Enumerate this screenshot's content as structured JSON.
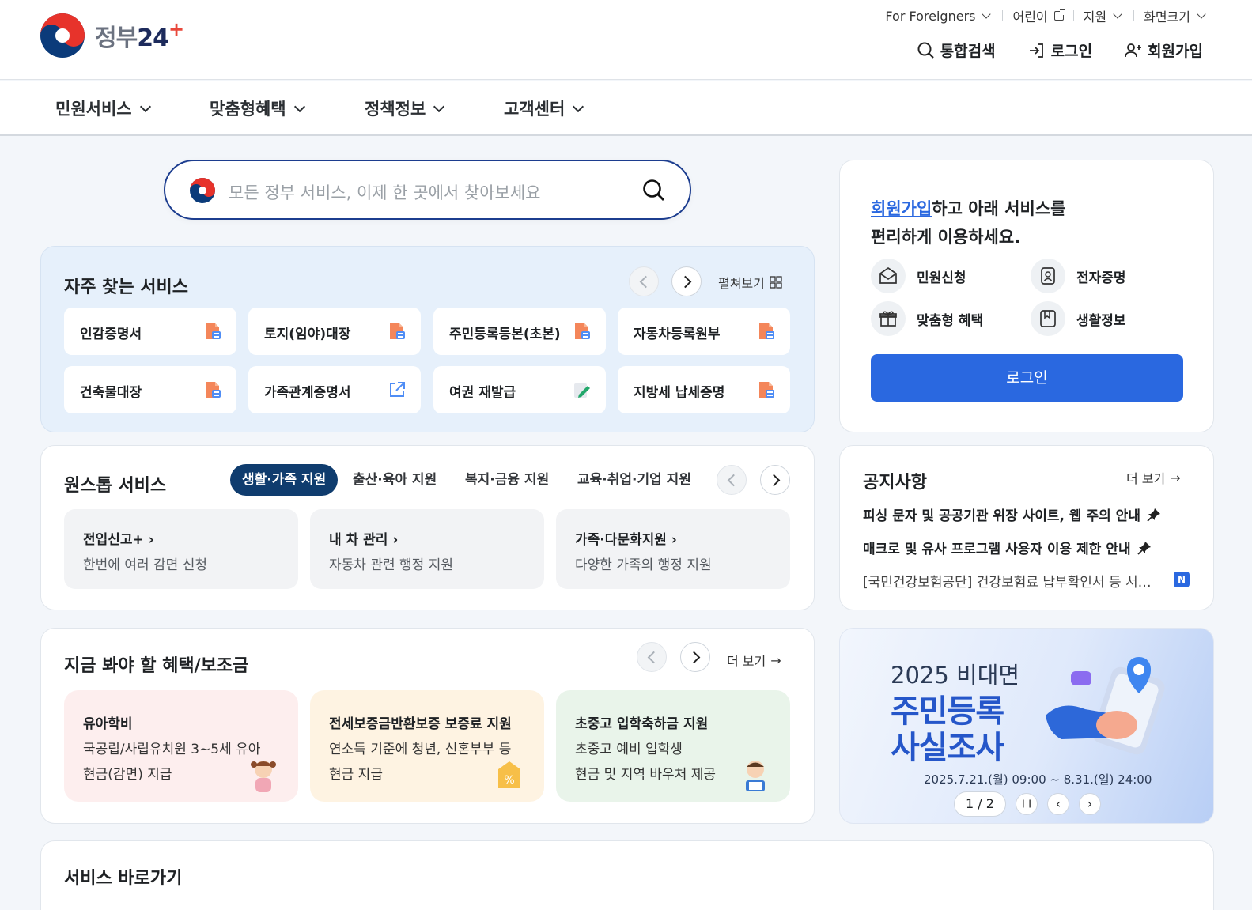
{
  "header": {
    "logo_text": "정부",
    "logo_num": "24",
    "logo_plus": "+",
    "util": {
      "foreigners": "For Foreigners",
      "kids": "어린이",
      "support": "지원",
      "screen_size": "화면크기"
    },
    "actions": {
      "search": "통합검색",
      "login": "로그인",
      "signup": "회원가입"
    }
  },
  "gnb": [
    "민원서비스",
    "맞춤형혜택",
    "정책정보",
    "고객센터"
  ],
  "search": {
    "placeholder": "모든 정부 서비스, 이제 한 곳에서 찾아보세요"
  },
  "frequent": {
    "title": "자주 찾는 서비스",
    "expand": "펼쳐보기",
    "tiles": [
      {
        "label": "인감증명서",
        "icon": "pdf-icon"
      },
      {
        "label": "토지(임야)대장",
        "icon": "pdf-icon"
      },
      {
        "label": "주민등록등본(초본)",
        "icon": "pdf-icon"
      },
      {
        "label": "자동차등록원부",
        "icon": "pdf-icon"
      },
      {
        "label": "건축물대장",
        "icon": "pdf-icon"
      },
      {
        "label": "가족관계증명서",
        "icon": "external-link-icon"
      },
      {
        "label": "여권 재발급",
        "icon": "edit-icon"
      },
      {
        "label": "지방세 납세증명",
        "icon": "pdf-icon"
      }
    ]
  },
  "onestop": {
    "title": "원스톱 서비스",
    "tabs": [
      "생활·가족 지원",
      "출산·육아 지원",
      "복지·금융 지원",
      "교육·취업·기업 지원"
    ],
    "items": [
      {
        "title": "전입신고+",
        "desc": "한번에 여러 감면 신청"
      },
      {
        "title": "내 차 관리",
        "desc": "자동차 관련 행정 지원"
      },
      {
        "title": "가족·다문화지원",
        "desc": "다양한 가족의 행정 지원"
      }
    ]
  },
  "benefits": {
    "title": "지금 봐야 할 혜택/보조금",
    "more": "더 보기",
    "items": [
      {
        "title": "유아학비",
        "line1": "국공립/사립유치원 3~5세 유아",
        "line2": "현금(감면) 지급",
        "bg": "#fdeeee"
      },
      {
        "title": "전세보증금반환보증 보증료 지원",
        "line1": "연소득 기준에 청년, 신혼부부 등",
        "line2": "현금 지급",
        "bg": "#fef3e2"
      },
      {
        "title": "초중고 입학축하금 지원",
        "line1": "초중고 예비 입학생",
        "line2": "현금 및 지역 바우처 제공",
        "bg": "#e9f4ea"
      }
    ]
  },
  "member": {
    "link": "회원가입",
    "text1": "하고 아래 서비스를",
    "text2": "편리하게 이용하세요.",
    "items": [
      "민원신청",
      "전자증명",
      "맞춤형 혜택",
      "생활정보"
    ],
    "login": "로그인"
  },
  "notice": {
    "title": "공지사항",
    "more": "더 보기",
    "items": [
      "피싱 문자 및 공공기관 위장 사이트, 웹 주의 안내",
      "매크로 및 유사 프로그램 사용자 이용 제한 안내",
      "[국민건강보험공단] 건강보험료 납부확인서 등 서…"
    ],
    "new_badge": "N"
  },
  "banner": {
    "line1": "2025 비대면",
    "line2": "주민등록",
    "line3": "사실조사",
    "date": "2025.7.21.(월) 09:00 ~ 8.31.(일) 24:00",
    "pager": "1 / 2"
  },
  "shortcuts": {
    "title": "서비스 바로가기"
  },
  "colors": {
    "primary": "#2a68e0",
    "navy": "#0f3c6e",
    "search_border": "#1c3d8f"
  }
}
